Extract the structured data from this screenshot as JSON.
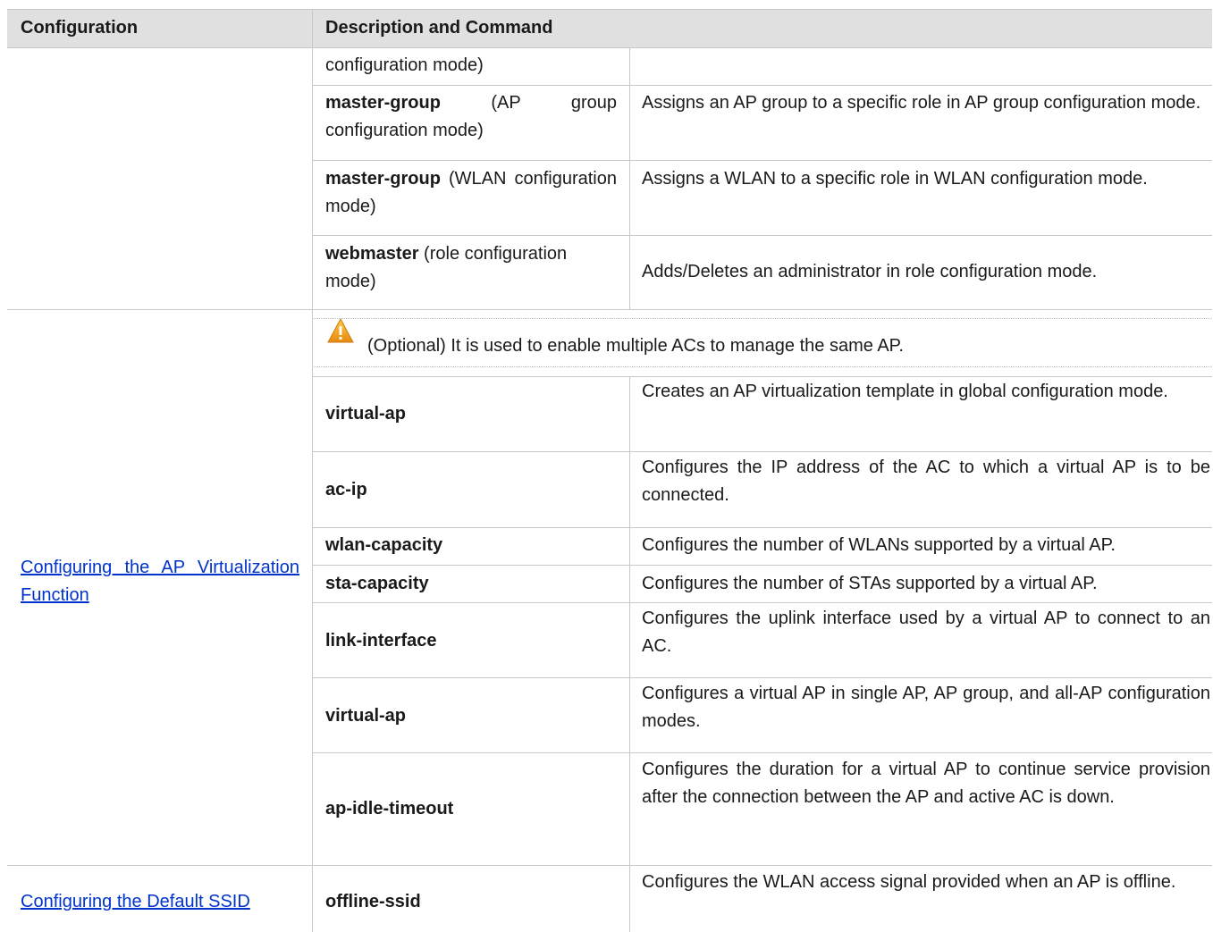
{
  "header": {
    "col1": "Configuration",
    "col2": "Description and Command"
  },
  "group1": {
    "rows": [
      {
        "cmd_pre": "",
        "cmd_bold": "",
        "cmd_rest": "configuration mode)",
        "desc": ""
      },
      {
        "cmd_bold": "master-group",
        "cmd_rest": " (AP group configuration mode)",
        "desc": "Assigns an AP group to a specific role in AP group configuration mode."
      },
      {
        "cmd_bold": "master-group",
        "cmd_rest": " (WLAN configuration mode)",
        "desc": "Assigns a WLAN to a specific role in WLAN configuration mode."
      },
      {
        "cmd_bold": "webmaster",
        "cmd_rest": " (role configuration mode)",
        "desc": "Adds/Deletes an administrator in role configuration mode."
      }
    ]
  },
  "group2": {
    "config_link": "Configuring the AP Virtualization Function",
    "note": "(Optional) It is used to enable multiple ACs to manage the same AP.",
    "rows": [
      {
        "cmd": "virtual-ap",
        "desc": "Creates an AP virtualization template in global configuration mode."
      },
      {
        "cmd": "ac-ip",
        "desc": "Configures the IP address of the AC to which a virtual AP is to be connected."
      },
      {
        "cmd": "wlan-capacity",
        "desc": "Configures the number of WLANs supported by a virtual AP."
      },
      {
        "cmd": "sta-capacity",
        "desc": "Configures the number of STAs supported by a virtual AP."
      },
      {
        "cmd": "link-interface",
        "desc": "Configures the uplink interface used by a virtual AP to connect to an AC."
      },
      {
        "cmd": "virtual-ap",
        "desc": "Configures a virtual AP in single AP, AP group, and all-AP configuration modes."
      },
      {
        "cmd": "ap-idle-timeout",
        "desc": "Configures the duration for a virtual AP to continue service provision after the connection between the AP and active AC is down."
      }
    ]
  },
  "group3": {
    "config_link": "Configuring the Default SSID",
    "cmd": "offline-ssid",
    "desc": "Configures the WLAN access signal provided when an AP is offline."
  },
  "icons": {
    "note_icon": "warning-triangle-icon",
    "note_color": "#f0a020"
  }
}
